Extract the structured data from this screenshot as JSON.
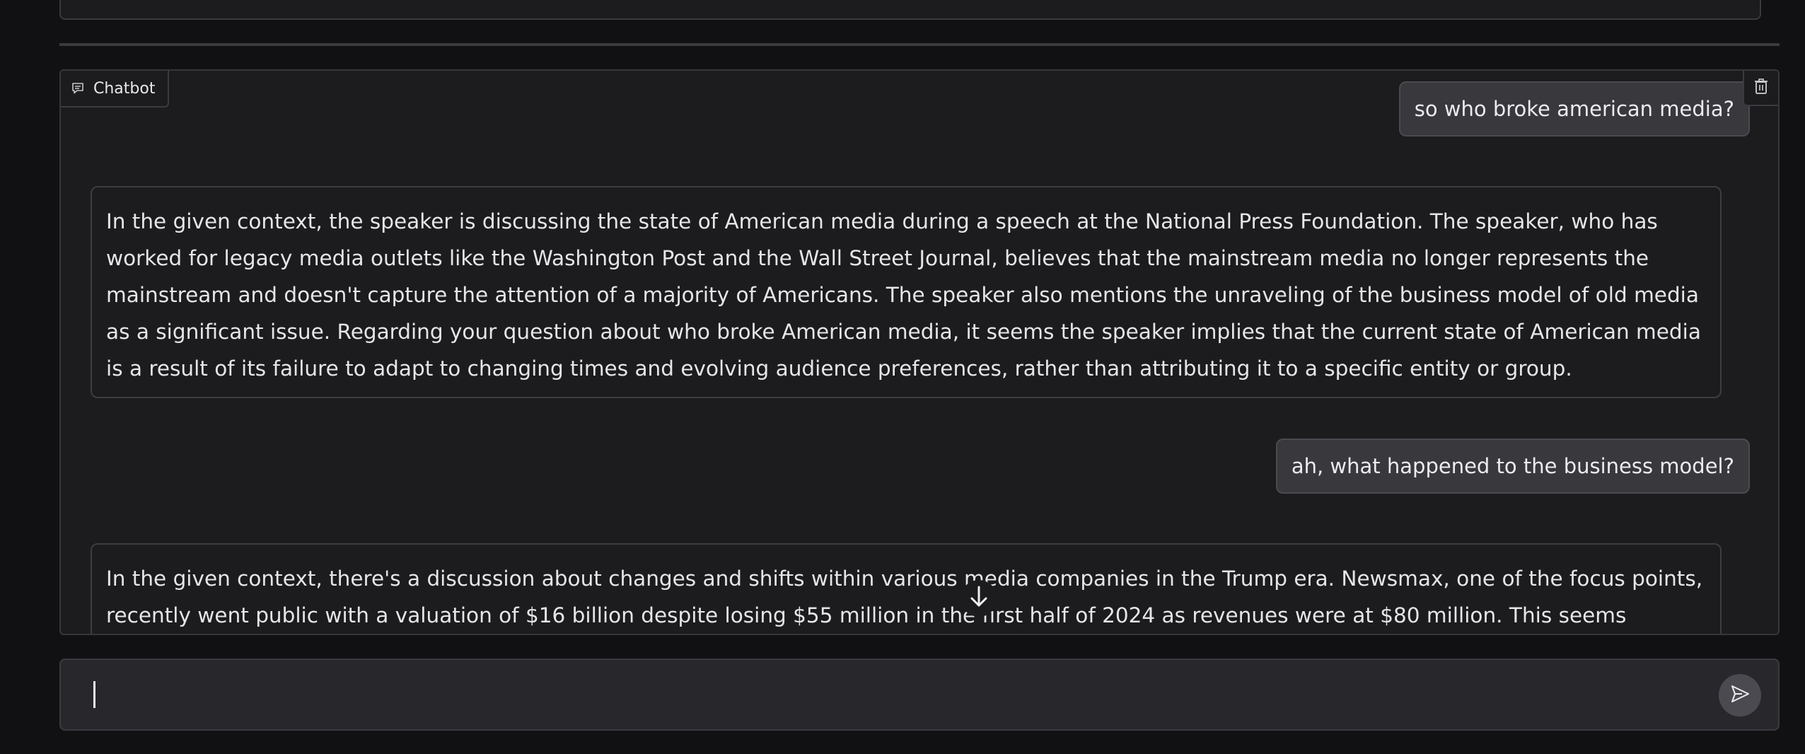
{
  "chatbot": {
    "label": "Chatbot",
    "icon": "chat-icon",
    "clear_icon": "trash-icon"
  },
  "messages": [
    {
      "role": "user",
      "text": "so who broke american media?"
    },
    {
      "role": "assistant",
      "text": "In the given context, the speaker is discussing the state of American media during a speech at the National Press Foundation. The speaker, who has worked for legacy media outlets like the Washington Post and the Wall Street Journal, believes that the mainstream media no longer represents the mainstream and doesn't capture the attention of a majority of Americans. The speaker also mentions the unraveling of the business model of old media as a significant issue. Regarding your question about who broke American media, it seems the speaker implies that the current state of American media is a result of its failure to adapt to changing times and evolving audience preferences, rather than attributing it to a specific entity or group."
    },
    {
      "role": "user",
      "text": "ah, what happened to the business model?"
    },
    {
      "role": "assistant",
      "text": "In the given context, there's a discussion about changes and shifts within various media companies in the Trump era. Newsmax, one of the focus points, recently went public with a valuation of $16 billion despite losing $55 million in the first half of 2024 as revenues were at $80 million. This seems surprising due to the traditional"
    }
  ],
  "scroll_icon": "arrow-down-icon",
  "input": {
    "value": "",
    "placeholder": ""
  },
  "send_icon": "send-icon"
}
